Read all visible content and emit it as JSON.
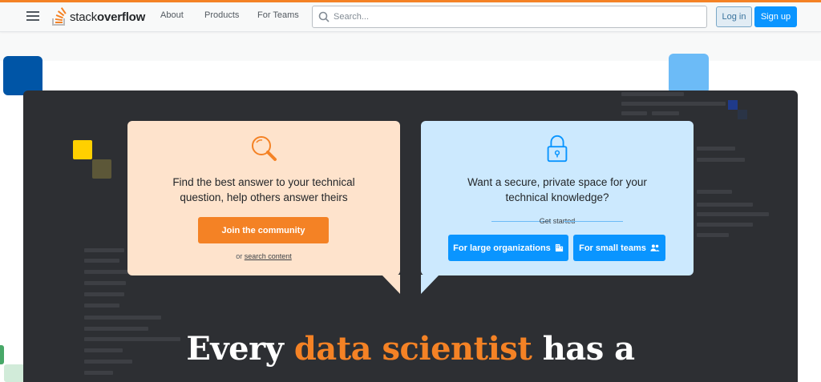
{
  "nav": {
    "logo_plain": "stack",
    "logo_bold": "overflow",
    "links": [
      "About",
      "Products",
      "For Teams"
    ],
    "search_placeholder": "Search...",
    "login_label": "Log in",
    "signup_label": "Sign up"
  },
  "icons": {
    "menu": "hamburger-icon",
    "search": "search-icon",
    "magnifier": "magnifier-icon",
    "lock": "lock-icon",
    "building": "building-icon",
    "people": "people-icon"
  },
  "community_card": {
    "text_line1": "Find the best answer to your technical",
    "text_line2": "question, help others answer theirs",
    "button_label": "Join the community",
    "or_text": "or",
    "search_link": "search content"
  },
  "teams_card": {
    "text_line1": "Want a secure, private space for your",
    "text_line2": "technical knowledge?",
    "get_started": "Get started",
    "large_org_label": "For large organizations",
    "small_teams_label": "For small teams"
  },
  "headline": {
    "part1": "Every ",
    "highlight": "data scientist",
    "part2": " has a"
  },
  "colors": {
    "brand_orange": "#f48225",
    "brand_blue": "#0a95ff",
    "dark_panel": "#2d2f33",
    "orange_card": "#fee3cc",
    "blue_card": "#cce9fe"
  }
}
